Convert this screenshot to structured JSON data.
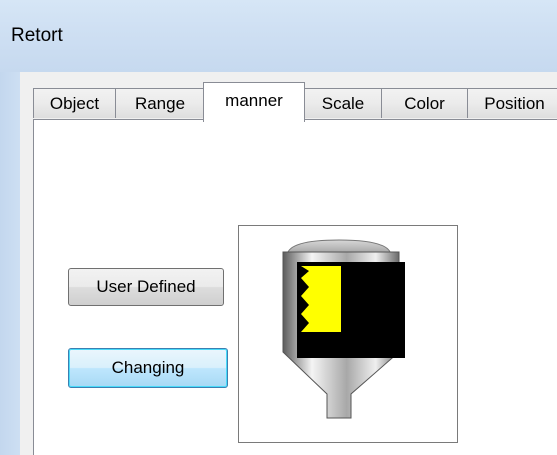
{
  "window": {
    "title": "Retort"
  },
  "tabs": [
    {
      "label": "Object"
    },
    {
      "label": "Range"
    },
    {
      "label": "manner",
      "active": true
    },
    {
      "label": "Scale"
    },
    {
      "label": "Color"
    },
    {
      "label": "Position"
    }
  ],
  "buttons": {
    "user_defined": "User Defined",
    "changing": "Changing"
  },
  "preview": {
    "fill_color": "#ffff00",
    "body_color": "#000000"
  }
}
